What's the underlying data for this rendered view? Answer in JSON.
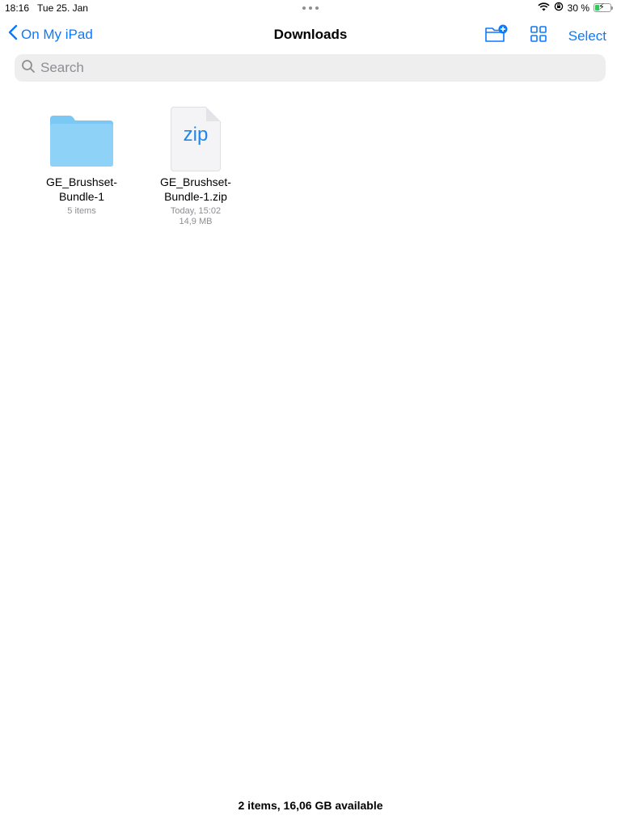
{
  "status_bar": {
    "time": "18:16",
    "date": "Tue 25. Jan",
    "battery_text": "30 %",
    "battery_level": 0.3
  },
  "nav": {
    "back_label": "On My iPad",
    "title": "Downloads",
    "select_label": "Select",
    "icons": [
      "chevron-left-icon",
      "new-folder-icon",
      "grid-view-icon"
    ]
  },
  "search": {
    "placeholder": "Search",
    "value": ""
  },
  "items": [
    {
      "type": "folder",
      "name": "GE_Brushset-Bundle-1",
      "name_line1": "GE_Brushset-",
      "name_line2": "Bundle-1",
      "meta": "5 items"
    },
    {
      "type": "zip",
      "icon_text": "zip",
      "name": "GE_Brushset-Bundle-1.zip",
      "name_line1": "GE_Brushset-",
      "name_line2": "Bundle-1.zip",
      "modified": "Today, 15:02",
      "size": "14,9 MB"
    }
  ],
  "footer": {
    "summary": "2 items, 16,06 GB available"
  },
  "colors": {
    "accent": "#0a7aff",
    "folder": "#7cc8f5",
    "secondary_text": "#8e8e93",
    "search_bg": "#eeeeef",
    "battery": "#34c759"
  }
}
